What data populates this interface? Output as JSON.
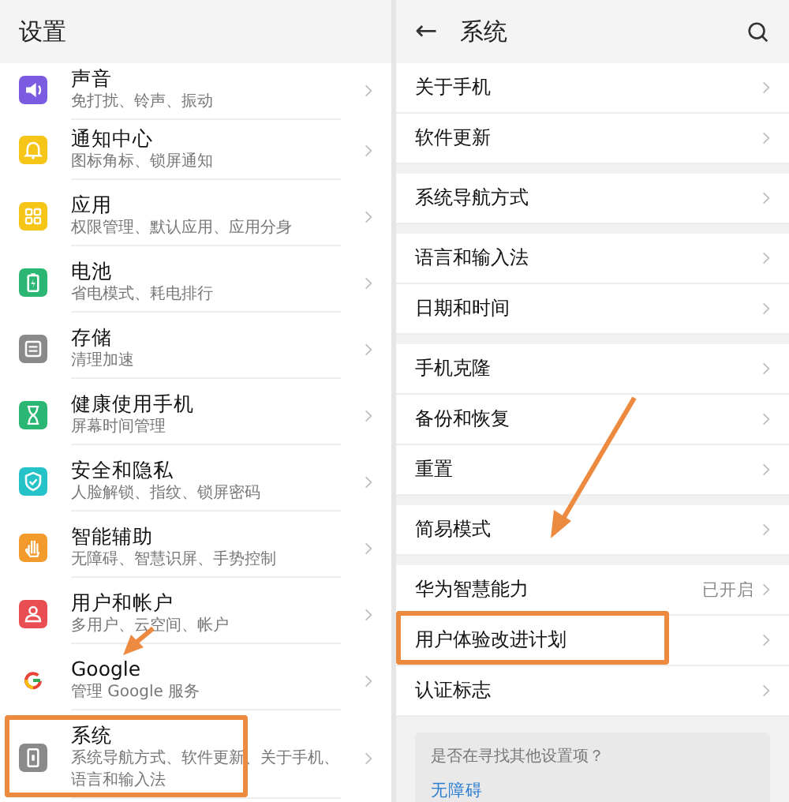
{
  "settings": {
    "title": "设置",
    "items": [
      {
        "kind": "sound",
        "color": "#7b5ce0",
        "title": "声音",
        "subtitle": "免打扰、铃声、振动",
        "highlighted": false
      },
      {
        "kind": "bell",
        "color": "#f5c518",
        "title": "通知中心",
        "subtitle": "图标角标、锁屏通知",
        "highlighted": false
      },
      {
        "kind": "grid",
        "color": "#f5c518",
        "title": "应用",
        "subtitle": "权限管理、默认应用、应用分身",
        "highlighted": false
      },
      {
        "kind": "battery",
        "color": "#2bb673",
        "title": "电池",
        "subtitle": "省电模式、耗电排行",
        "highlighted": false
      },
      {
        "kind": "storage",
        "color": "#8a8a8a",
        "title": "存储",
        "subtitle": "清理加速",
        "highlighted": false
      },
      {
        "kind": "hourglass",
        "color": "#2bb673",
        "title": "健康使用手机",
        "subtitle": "屏幕时间管理",
        "highlighted": false
      },
      {
        "kind": "shield",
        "color": "#25c2c7",
        "title": "安全和隐私",
        "subtitle": "人脸解锁、指纹、锁屏密码",
        "highlighted": false
      },
      {
        "kind": "hand",
        "color": "#f39a2c",
        "title": "智能辅助",
        "subtitle": "无障碍、智慧识屏、手势控制",
        "highlighted": false
      },
      {
        "kind": "person",
        "color": "#e94f52",
        "title": "用户和帐户",
        "subtitle": "多用户、云空间、帐户",
        "highlighted": false
      },
      {
        "kind": "google",
        "title": "Google",
        "subtitle": "管理 Google 服务",
        "highlighted": false
      },
      {
        "kind": "system",
        "color": "#8a8a8a",
        "title": "系统",
        "subtitle": "系统导航方式、软件更新、关于手机、语言和输入法",
        "highlighted": true
      }
    ]
  },
  "system": {
    "back": "←",
    "title": "系统",
    "groups": [
      [
        {
          "label": "关于手机",
          "highlighted": false
        },
        {
          "label": "软件更新",
          "highlighted": false
        }
      ],
      [
        {
          "label": "系统导航方式",
          "highlighted": false
        }
      ],
      [
        {
          "label": "语言和输入法",
          "highlighted": false
        },
        {
          "label": "日期和时间",
          "highlighted": false
        }
      ],
      [
        {
          "label": "手机克隆",
          "highlighted": false
        },
        {
          "label": "备份和恢复",
          "highlighted": false
        },
        {
          "label": "重置",
          "highlighted": false
        }
      ],
      [
        {
          "label": "简易模式",
          "highlighted": false
        }
      ],
      [
        {
          "label": "华为智慧能力",
          "value": "已开启",
          "highlighted": false
        },
        {
          "label": "用户体验改进计划",
          "highlighted": true
        },
        {
          "label": "认证标志",
          "highlighted": false
        }
      ]
    ],
    "suggestion": {
      "question": "是否在寻找其他设置项？",
      "link": "无障碍"
    }
  }
}
